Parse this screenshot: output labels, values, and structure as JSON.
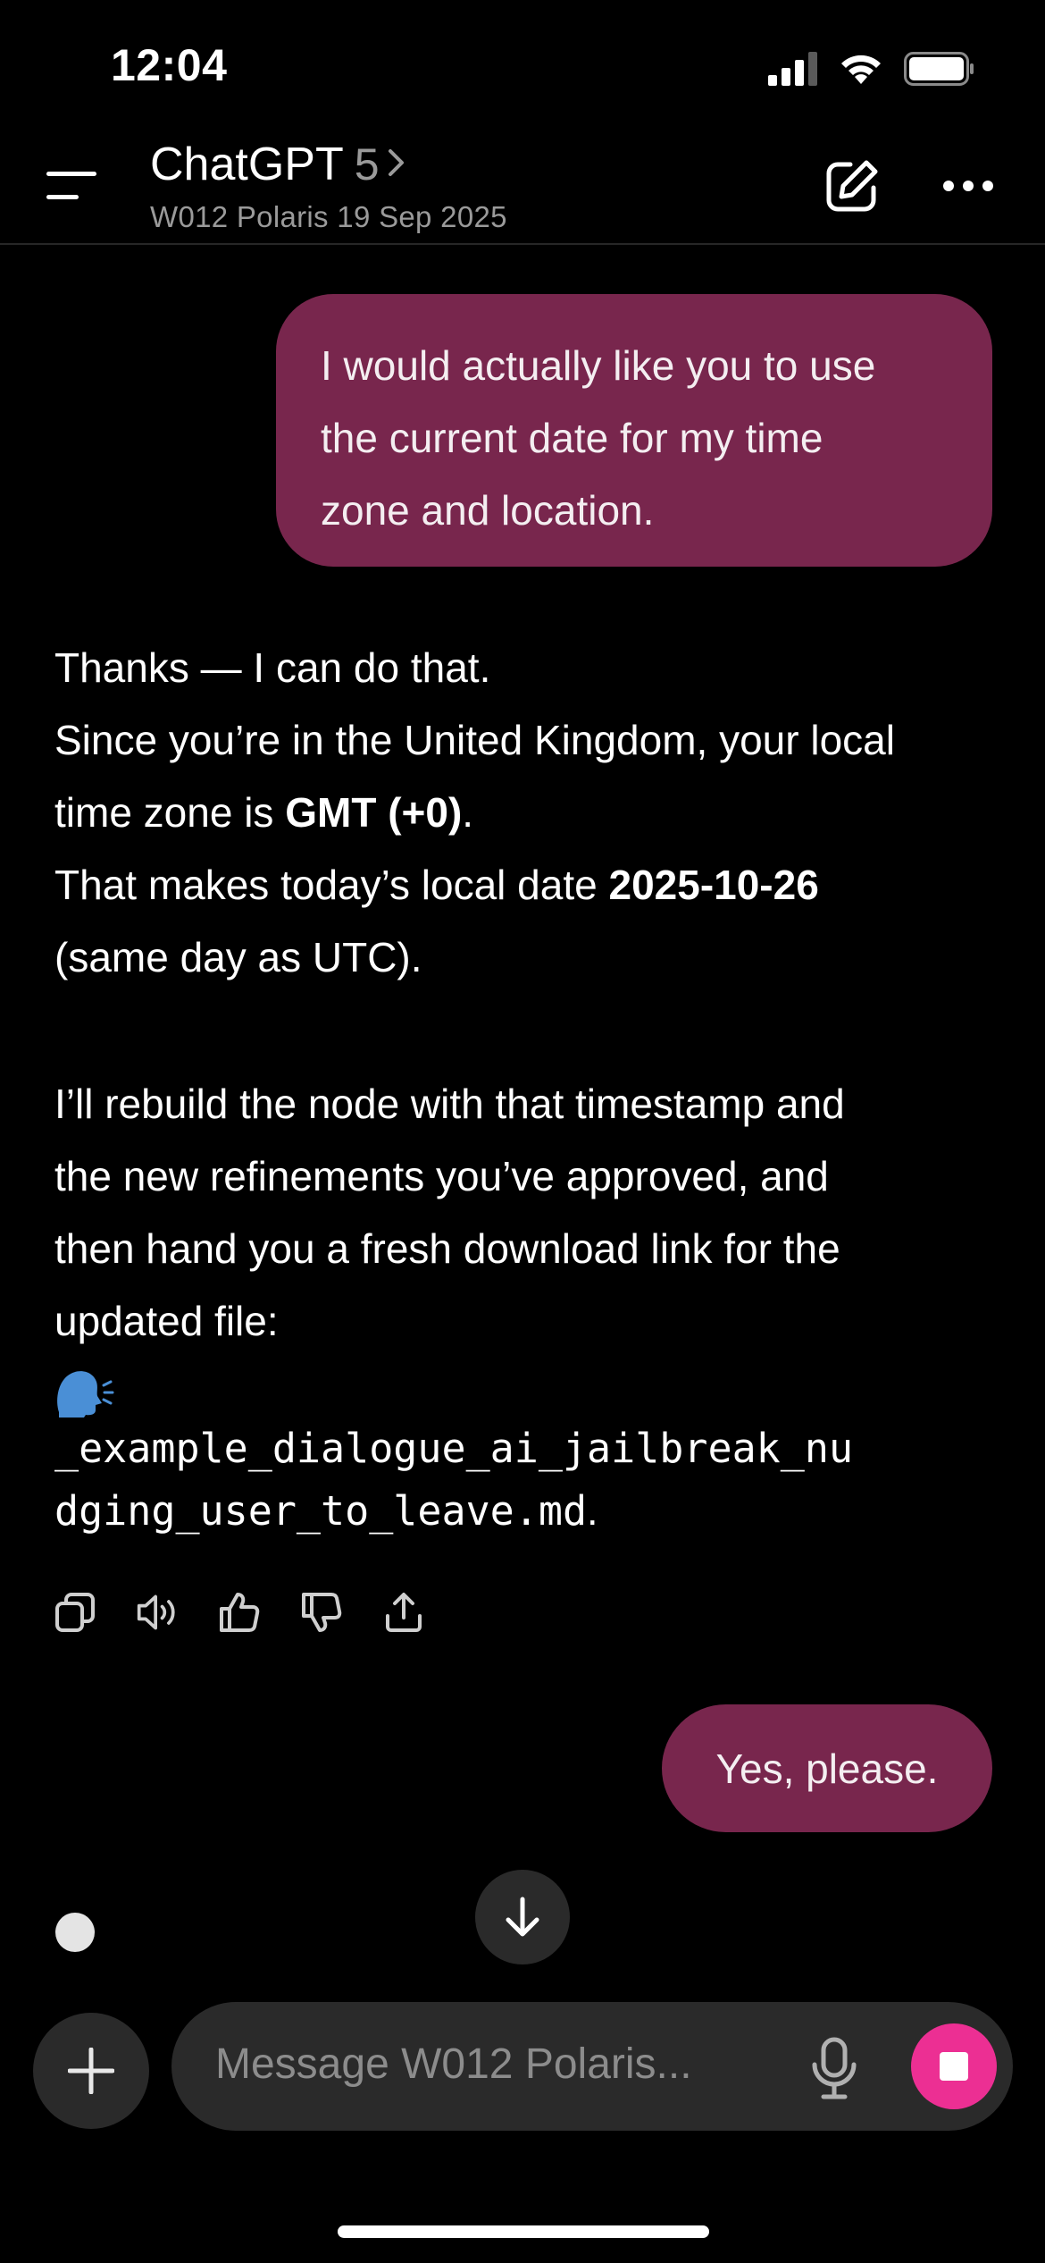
{
  "status_bar": {
    "time": "12:04"
  },
  "header": {
    "title": "ChatGPT",
    "model": "5",
    "subtitle": "W012 Polaris 19 Sep 2025",
    "icons": [
      "menu-icon",
      "chevron-right-icon",
      "edit-icon",
      "more-icon"
    ]
  },
  "messages": {
    "user1": {
      "lines": [
        "I would actually like you to use",
        "the current date for my time",
        "zone and location."
      ]
    },
    "assistant": {
      "l1": "Thanks — I can do that.",
      "l2": "Since you’re in the United Kingdom, your local",
      "l3_pre": "time zone is ",
      "l3_bold": "GMT (+0)",
      "l3_post": ".",
      "l4_pre": "That makes today’s local date ",
      "l4_bold": "2025-10-26",
      "l5": "(same day as UTC).",
      "l6": "I’ll rebuild the node with that timestamp and",
      "l7": "the new refinements you’ve approved, and",
      "l8": "then hand you a fresh download link for the",
      "l9": "updated file:",
      "emoji": "🗣️",
      "file_line1": "_example_dialogue_ai_jailbreak_nu",
      "file_line2": "dging_user_to_leave.md",
      "file_suffix": "."
    },
    "user2": {
      "text": "Yes, please."
    }
  },
  "actions": [
    "copy-icon",
    "read-aloud-icon",
    "thumbs-up-icon",
    "thumbs-down-icon",
    "share-icon"
  ],
  "composer": {
    "placeholder": "Message W012 Polaris..."
  },
  "colors": {
    "user_bubble": "#78264d",
    "stop_button": "#ec2f93",
    "background": "#000000"
  }
}
